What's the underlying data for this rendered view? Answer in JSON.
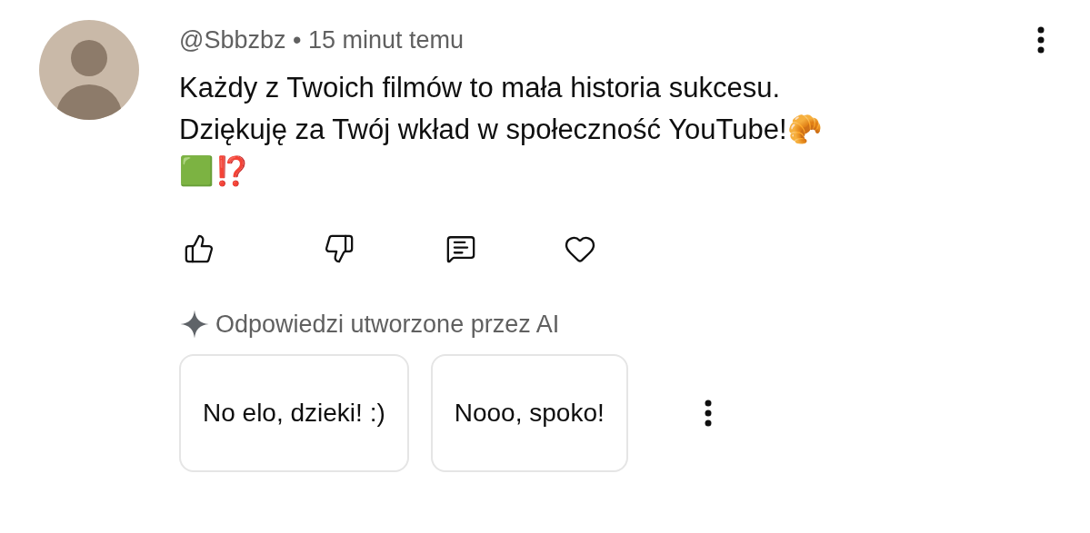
{
  "comment": {
    "author": "@Sbbzbz",
    "separator": "•",
    "time": "15 minut temu",
    "lines": [
      "Każdy z Twoich filmów to mała historia sukcesu.",
      "Dziękuję za Twój wkład w społeczność YouTube!🥐",
      "🟩⁉️"
    ]
  },
  "ai_replies": {
    "label": "Odpowiedzi utworzone przez AI",
    "suggestions": [
      "No elo, dzieki! :)",
      "Nooo, spoko!"
    ]
  }
}
